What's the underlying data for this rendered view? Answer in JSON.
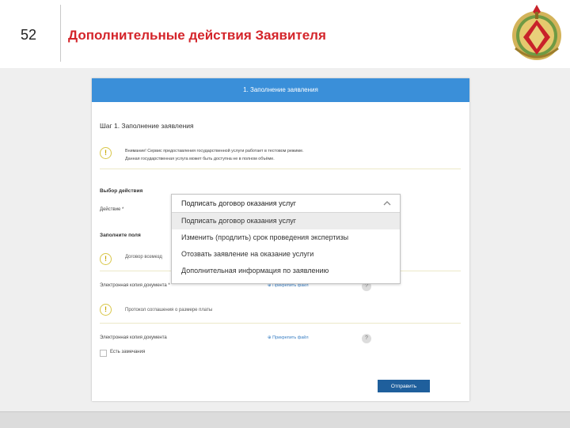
{
  "slide": {
    "number": "52",
    "title": "Дополнительные действия Заявителя"
  },
  "app": {
    "header_title": "1. Заполнение заявления",
    "step_title": "Шаг 1. Заполнение заявления",
    "notice_line1": "Внимание! Сервис предоставления государственной услуги работает в тестовом режиме.",
    "notice_line2": "Данная государственная услуга может быть доступна не в полном объёме.",
    "choose_action_heading": "Выбор действия",
    "action_label": "Действие *",
    "fill_fields_heading": "Заполните поля",
    "contract_text": "Договор возмезд",
    "ecopy_required_label": "Электронная копия документа *",
    "attach_file_1": "Прикрепить файл",
    "protocol_text": "Протокол соглашения о размере платы",
    "ecopy_label": "Электронная копия документа",
    "attach_file_2": "Прикрепить файл",
    "remarks_label": "Есть замечания",
    "submit_label": "Отправить",
    "help_glyph": "?",
    "warn_glyph": "!"
  },
  "dropdown": {
    "selected": "Подписать договор оказания услуг",
    "options": [
      "Подписать договор оказания услуг",
      "Изменить (продлить) срок проведения экспертизы",
      "Отозвать заявление на оказание услуги",
      "Дополнительная информация по заявлению"
    ],
    "highlighted_index": 0
  },
  "colors": {
    "title": "#d4252b",
    "app_header": "#3a8fd9",
    "submit": "#1f5f9c",
    "link": "#3a7fc4",
    "warning": "#c9a800"
  }
}
